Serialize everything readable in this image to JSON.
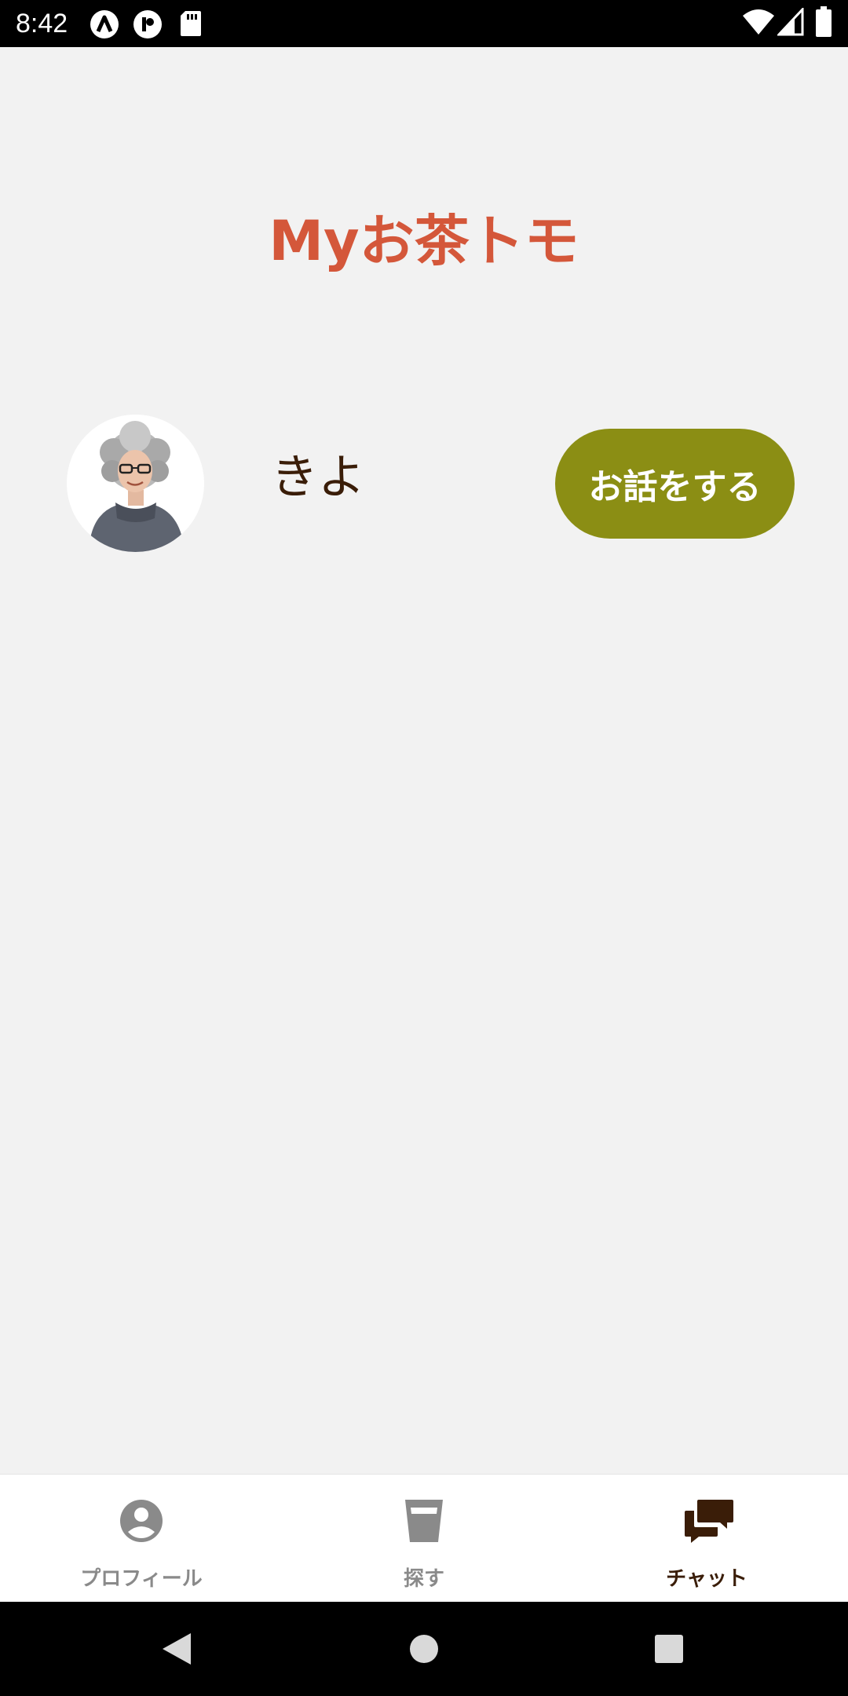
{
  "status_bar": {
    "time": "8:42",
    "icons": [
      "a-logo-icon",
      "p-logo-icon",
      "sd-card-icon",
      "wifi-icon",
      "signal-icon",
      "battery-icon"
    ]
  },
  "page": {
    "title": "Myお茶トモ",
    "title_color": "#d4573a"
  },
  "friends": [
    {
      "name": "きよ",
      "avatar": "avatar-photo",
      "action_label": "お話をする"
    }
  ],
  "colors": {
    "background": "#f2f2f2",
    "button": "#8b8e14",
    "name_text": "#3a1d08",
    "nav_active": "#3a1d08",
    "nav_inactive": "#8a8a8a"
  },
  "bottom_nav": {
    "items": [
      {
        "label": "プロフィール",
        "icon": "account-circle-icon",
        "active": false
      },
      {
        "label": "探す",
        "icon": "cup-icon",
        "active": false
      },
      {
        "label": "チャット",
        "icon": "chat-bubbles-icon",
        "active": true
      }
    ]
  },
  "system_nav": {
    "icons": [
      "back-icon",
      "home-icon",
      "recents-icon"
    ]
  }
}
